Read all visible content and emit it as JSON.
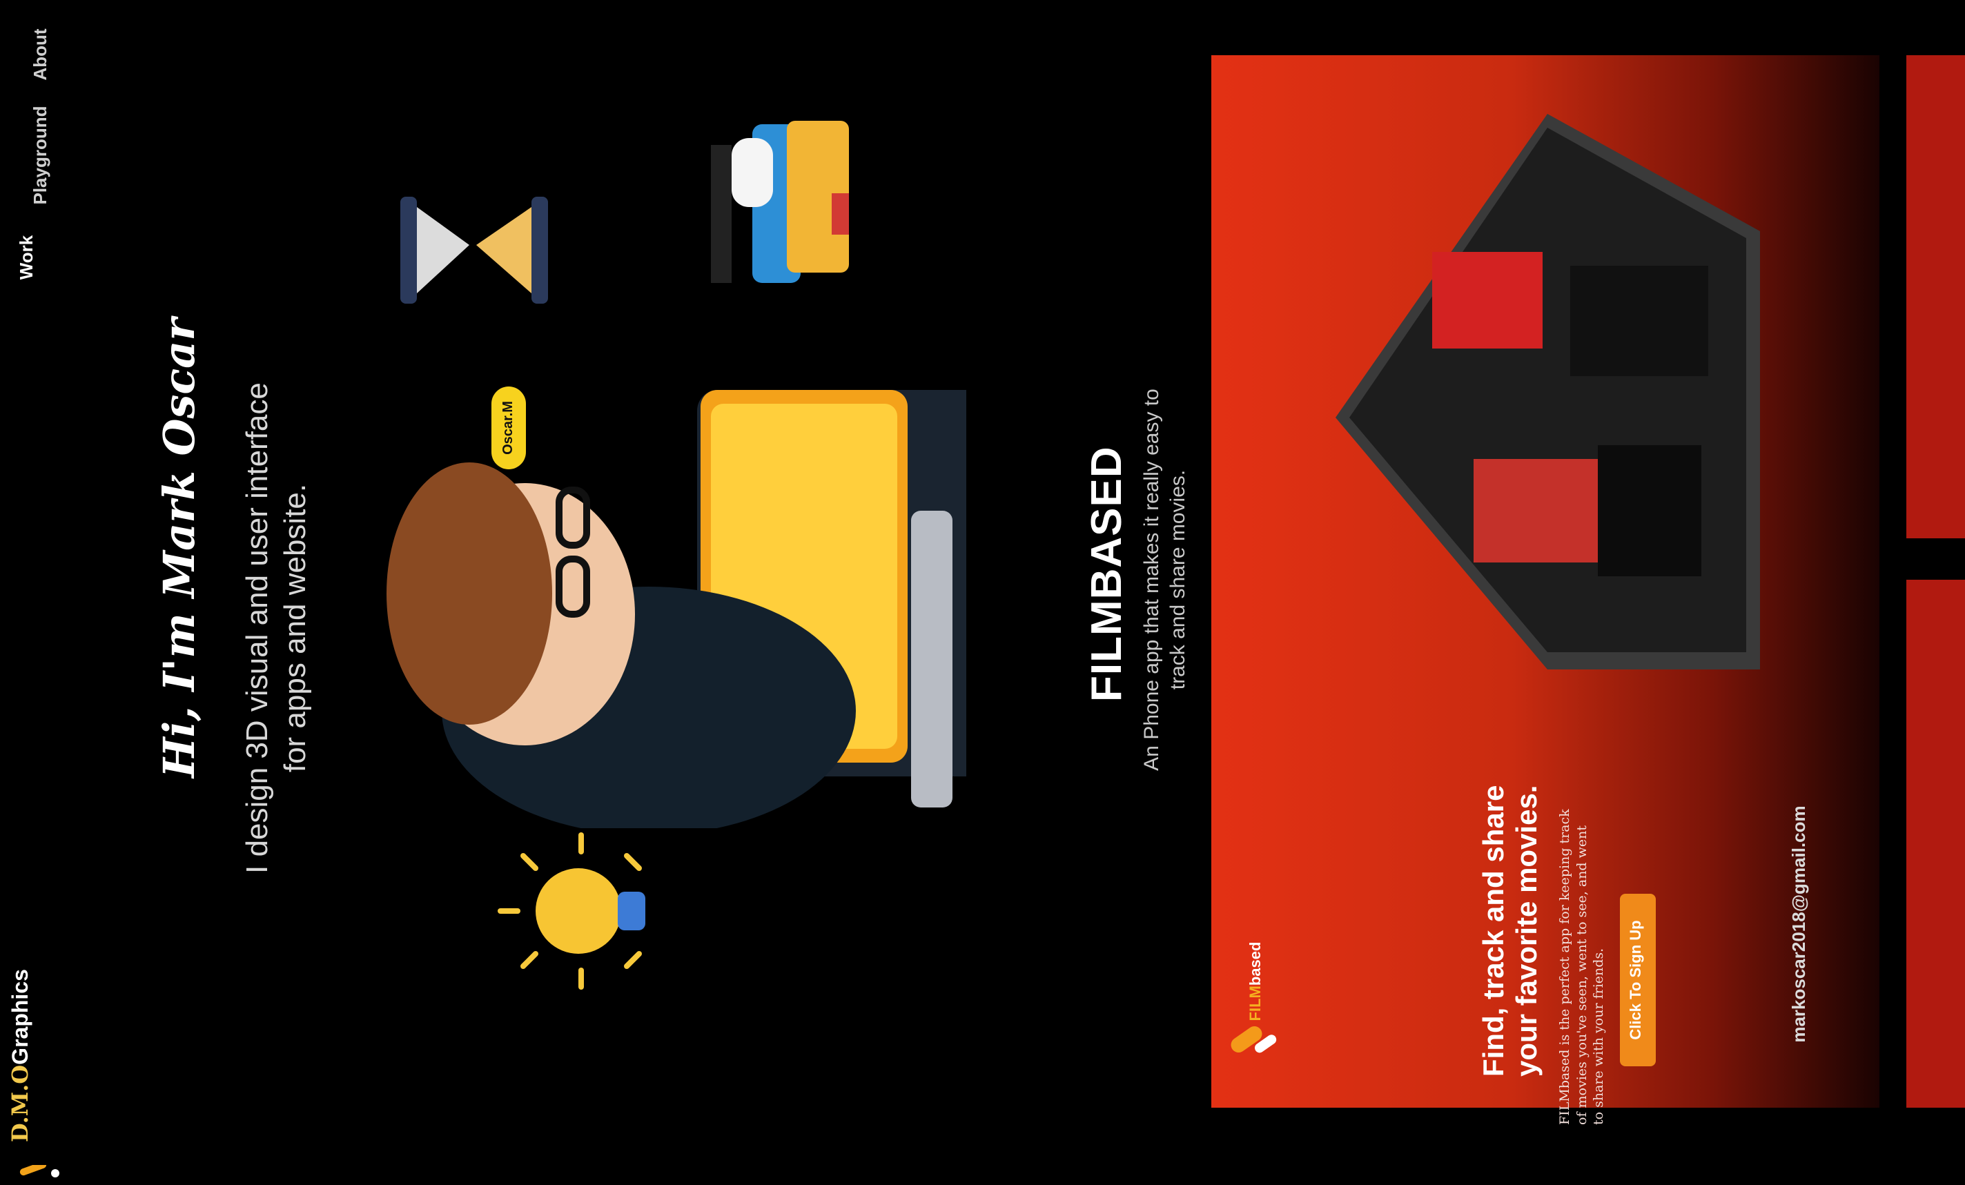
{
  "header": {
    "logo": {
      "mark": "D.M.O",
      "name": "Graphics"
    },
    "nav": [
      {
        "label": "Work"
      },
      {
        "label": "Playground"
      },
      {
        "label": "About"
      }
    ]
  },
  "hero": {
    "title": "Hi, I'm Mark Oscar",
    "subtitle_line1": "I design 3D visual and user interface",
    "subtitle_line2": "for apps and website.",
    "speech_bubble": "Oscar.M"
  },
  "project": {
    "title": "FILMBASED",
    "desc_line1": "An Phone app that makes it really easy to",
    "desc_line2": "track and share movies."
  },
  "card": {
    "brand_part1": "FILM",
    "brand_part2": "based",
    "headline_line1": "Find, track and share",
    "headline_line2": "your favorite movies.",
    "body_line1": "FILMbased is the perfect app for keeping track",
    "body_line2": "of movies you've seen, went to see, and went",
    "body_line3": "to share with your friends.",
    "cta_label": "Click To Sign Up",
    "email": "markoscar2018@gmail.com"
  },
  "colors": {
    "background": "#000000",
    "accent_yellow": "#f2c94c",
    "card_red": "#e33114",
    "cta_orange": "#f08a1a"
  },
  "icons": [
    "lightbulb-icon",
    "hourglass-icon",
    "graduation-icon",
    "avatar-illustration",
    "room-illustration"
  ]
}
